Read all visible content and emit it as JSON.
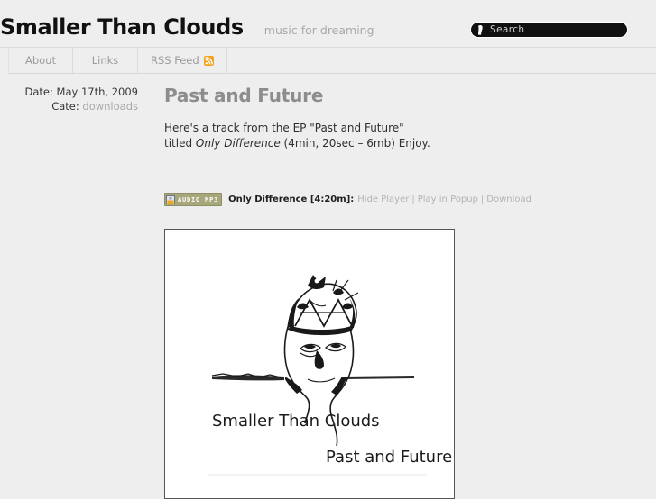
{
  "header": {
    "site_title": "Smaller Than Clouds",
    "tagline": "music for dreaming"
  },
  "search": {
    "placeholder": "Search",
    "value": "",
    "icon": "search-icon"
  },
  "nav": {
    "items": [
      {
        "label": "About",
        "icon": null
      },
      {
        "label": "Links",
        "icon": null
      },
      {
        "label": "RSS Feed",
        "icon": "rss-icon"
      }
    ]
  },
  "sidebar": {
    "date_label": "Date:",
    "date_value": "May 17th, 2009",
    "category_label": "Cate:",
    "category_value": "downloads"
  },
  "post": {
    "title": "Past and Future",
    "body_line1": "Here's a track from the EP \"Past and Future\"",
    "body_line2_prefix": "titled ",
    "body_line2_italic": "Only Difference",
    "body_line2_suffix": " (4min, 20sec – 6mb)  Enjoy."
  },
  "player": {
    "badge_text": "AUDIO MP3",
    "badge_icon": "audio-file-icon",
    "track_label": "Only Difference [4:20m]:",
    "links": [
      {
        "label": "Hide Player"
      },
      {
        "label": "Play in Popup"
      },
      {
        "label": "Download"
      }
    ],
    "separator": "|"
  },
  "artwork": {
    "alt": "Past and Future album cover",
    "caption_artist": "Smaller Than Clouds",
    "caption_title": "Past and Future"
  },
  "colors": {
    "page_background": "#eeeeee",
    "title_text": "#111111",
    "tagline_text": "#a9a9a9",
    "nav_text": "#9b9b9b",
    "post_title": "#8d8d8d",
    "link_grey": "#b3b3b3",
    "rss_orange": "#f3a11c",
    "audio_badge": "#a7a77c",
    "search_background": "#111111"
  }
}
